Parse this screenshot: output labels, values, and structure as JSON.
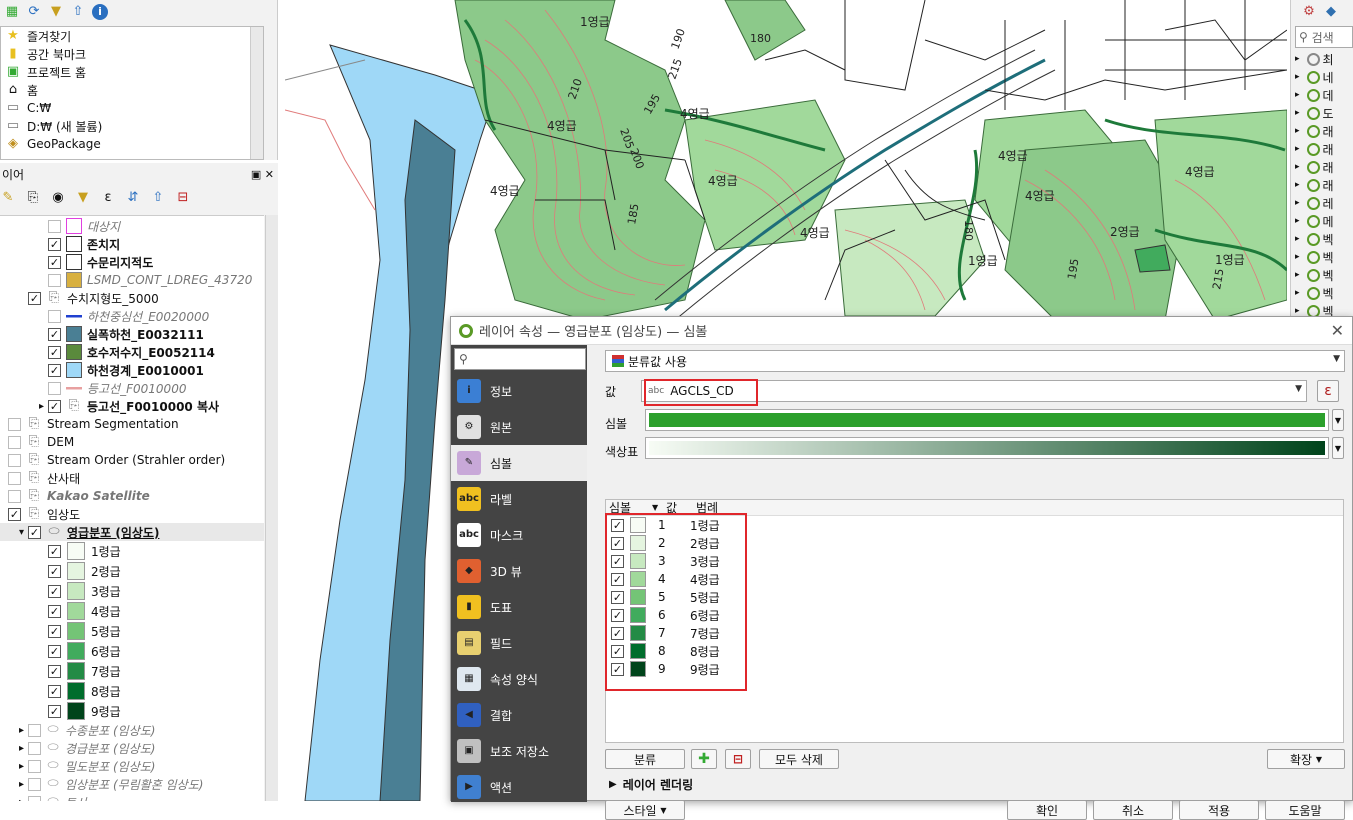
{
  "browser": {
    "items": [
      {
        "icon": "star-icon",
        "label": "즐겨찾기"
      },
      {
        "icon": "bookmark-icon",
        "label": "공간 북마크"
      },
      {
        "icon": "project-home-icon",
        "label": "프로젝트 홈"
      },
      {
        "icon": "home-icon",
        "label": "홈"
      },
      {
        "icon": "folder-icon",
        "label": "C:₩"
      },
      {
        "icon": "folder-icon",
        "label": "D:₩ (새 볼륨)"
      },
      {
        "icon": "geopackage-icon",
        "label": "GeoPackage"
      }
    ]
  },
  "layers": {
    "title": "이어",
    "rows": [
      {
        "indent": 2,
        "checked": false,
        "swatch": "#ffffff",
        "swatch_border": "#e040e0",
        "label": "대상지",
        "style": "it",
        "expander": ""
      },
      {
        "indent": 2,
        "checked": true,
        "swatch": "#ffffff",
        "swatch_border": "#333",
        "label": "존치지",
        "style": "b",
        "expander": ""
      },
      {
        "indent": 2,
        "checked": true,
        "swatch": "#ffffff",
        "swatch_border": "#333",
        "label": "수문리지적도",
        "style": "b",
        "expander": ""
      },
      {
        "indent": 2,
        "checked": false,
        "swatch": "#d8b040",
        "swatch_border": "#888",
        "label": "LSMD_CONT_LDREG_43720",
        "style": "it",
        "expander": ""
      },
      {
        "indent": 1,
        "checked": true,
        "swatch": "",
        "swatch_border": "",
        "label": "수치지형도_5000",
        "style": "",
        "expander": ""
      },
      {
        "indent": 2,
        "checked": false,
        "swatch": "#2040d0",
        "swatch_border": "",
        "label": "하천중심선_E0020000",
        "style": "it",
        "expander": "",
        "line": true
      },
      {
        "indent": 2,
        "checked": true,
        "swatch": "#4a7f94",
        "swatch_border": "#555",
        "label": "실폭하천_E0032111",
        "style": "b",
        "expander": ""
      },
      {
        "indent": 2,
        "checked": true,
        "swatch": "#5a8a3c",
        "swatch_border": "#555",
        "label": "호수저수지_E0052114",
        "style": "b",
        "expander": ""
      },
      {
        "indent": 2,
        "checked": true,
        "swatch": "#9fd8f7",
        "swatch_border": "#555",
        "label": "하천경계_E0010001",
        "style": "b",
        "expander": ""
      },
      {
        "indent": 2,
        "checked": false,
        "swatch": "#e8a0a0",
        "swatch_border": "",
        "label": "등고선_F0010000",
        "style": "it",
        "expander": "",
        "line": true
      },
      {
        "indent": 2,
        "checked": true,
        "swatch": "",
        "swatch_border": "",
        "label": "등고선_F0010000 복사",
        "style": "b",
        "expander": "▸"
      },
      {
        "indent": 0,
        "checked": false,
        "swatch": "",
        "swatch_border": "",
        "label": "Stream Segmentation",
        "style": "",
        "expander": ""
      },
      {
        "indent": 0,
        "checked": false,
        "swatch": "",
        "swatch_border": "",
        "label": "DEM",
        "style": "",
        "expander": ""
      },
      {
        "indent": 0,
        "checked": false,
        "swatch": "",
        "swatch_border": "",
        "label": "Stream Order (Strahler order)",
        "style": "",
        "expander": ""
      },
      {
        "indent": 0,
        "checked": false,
        "swatch": "",
        "swatch_border": "",
        "label": "산사태",
        "style": "",
        "expander": ""
      },
      {
        "indent": 0,
        "checked": false,
        "swatch": "",
        "swatch_border": "",
        "label": "Kakao Satellite",
        "style": "itb",
        "expander": ""
      },
      {
        "indent": 0,
        "checked": true,
        "swatch": "",
        "swatch_border": "",
        "label": "임상도",
        "style": "",
        "expander": ""
      },
      {
        "indent": 1,
        "checked": true,
        "swatch": "",
        "swatch_border": "",
        "label": "영급분포 (임상도)",
        "style": "bu",
        "expander": "▾"
      }
    ],
    "classes": [
      {
        "label": "1령급",
        "color": "#f7fcf5"
      },
      {
        "label": "2령급",
        "color": "#e5f5e0"
      },
      {
        "label": "3령급",
        "color": "#c7e9c0"
      },
      {
        "label": "4령급",
        "color": "#a1d99b"
      },
      {
        "label": "5령급",
        "color": "#74c476"
      },
      {
        "label": "6령급",
        "color": "#41ab5d"
      },
      {
        "label": "7령급",
        "color": "#238b45"
      },
      {
        "label": "8령급",
        "color": "#006d2c"
      },
      {
        "label": "9령급",
        "color": "#00441b"
      }
    ],
    "bottom_rows": [
      {
        "label": "수종분포 (임상도)"
      },
      {
        "label": "경급분포 (임상도)"
      },
      {
        "label": "밀도분포 (임상도)"
      },
      {
        "label": "임상분포 (무림활혼 임상도)"
      },
      {
        "label": "토사"
      }
    ]
  },
  "right_panel": {
    "search_placeholder": "검색",
    "items": [
      "최",
      "네",
      "데",
      "도",
      "래",
      "래",
      "래",
      "래",
      "레",
      "메",
      "벡",
      "벡",
      "벡",
      "벡",
      "벡"
    ]
  },
  "map": {
    "labels": [
      "1영급",
      "4영급",
      "4영급",
      "4영급",
      "4영급",
      "4영급",
      "4영급",
      "4영급",
      "4영급",
      "2영급",
      "1영급",
      "1영급",
      "210",
      "215",
      "190",
      "180",
      "205",
      "200",
      "195",
      "185",
      "180",
      "215",
      "195"
    ]
  },
  "dialog": {
    "title": "레이어 속성 — 영급분포 (임상도) — 심볼",
    "search_placeholder": "",
    "side_items": [
      {
        "label": "정보",
        "icon": "info-icon",
        "color": "#3b7fd4",
        "glyph": "i"
      },
      {
        "label": "원본",
        "icon": "source-icon",
        "color": "#e0e0e0",
        "glyph": "⚙"
      },
      {
        "label": "심볼",
        "icon": "symbology-icon",
        "color": "#c8a8d8",
        "glyph": "✎",
        "selected": true
      },
      {
        "label": "라벨",
        "icon": "labels-icon",
        "color": "#f0c020",
        "glyph": "abc"
      },
      {
        "label": "마스크",
        "icon": "mask-icon",
        "color": "#ffffff",
        "glyph": "abc"
      },
      {
        "label": "3D 뷰",
        "icon": "3d-view-icon",
        "color": "#e06030",
        "glyph": "◆"
      },
      {
        "label": "도표",
        "icon": "diagrams-icon",
        "color": "#f0c020",
        "glyph": "▮"
      },
      {
        "label": "필드",
        "icon": "fields-icon",
        "color": "#e8d070",
        "glyph": "▤"
      },
      {
        "label": "속성 양식",
        "icon": "attributes-form-icon",
        "color": "#dfe8f0",
        "glyph": "▦"
      },
      {
        "label": "결합",
        "icon": "joins-icon",
        "color": "#3060c0",
        "glyph": "◀"
      },
      {
        "label": "보조 저장소",
        "icon": "auxiliary-storage-icon",
        "color": "#c0c0c0",
        "glyph": "▣"
      },
      {
        "label": "액션",
        "icon": "actions-icon",
        "color": "#4080d0",
        "glyph": "▶"
      }
    ],
    "renderer": "분류값 사용",
    "value_label": "값",
    "value_type": "abc",
    "value_field": "AGCLS_CD",
    "symbol_label": "심볼",
    "symbol_color": "#2ca02c",
    "ramp_label": "색상표",
    "ramp_from": "#f7fcf5",
    "ramp_to": "#00441b",
    "table_headers": {
      "symbol": "심볼",
      "value": "값",
      "legend": "범례"
    },
    "categories": [
      {
        "value": "1",
        "legend": "1령급",
        "color": "#f7fcf5"
      },
      {
        "value": "2",
        "legend": "2령급",
        "color": "#e5f5e0"
      },
      {
        "value": "3",
        "legend": "3령급",
        "color": "#c7e9c0"
      },
      {
        "value": "4",
        "legend": "4령급",
        "color": "#a1d99b"
      },
      {
        "value": "5",
        "legend": "5령급",
        "color": "#74c476"
      },
      {
        "value": "6",
        "legend": "6령급",
        "color": "#41ab5d"
      },
      {
        "value": "7",
        "legend": "7령급",
        "color": "#238b45"
      },
      {
        "value": "8",
        "legend": "8령급",
        "color": "#006d2c"
      },
      {
        "value": "9",
        "legend": "9령급",
        "color": "#00441b"
      }
    ],
    "classify_button": "분류",
    "delete_all_button": "모두 삭제",
    "advanced_button": "확장",
    "layer_rendering": "레이어 렌더링",
    "style_button": "스타일",
    "ok_button": "확인",
    "cancel_button": "취소",
    "apply_button": "적용",
    "help_button": "도움말"
  }
}
